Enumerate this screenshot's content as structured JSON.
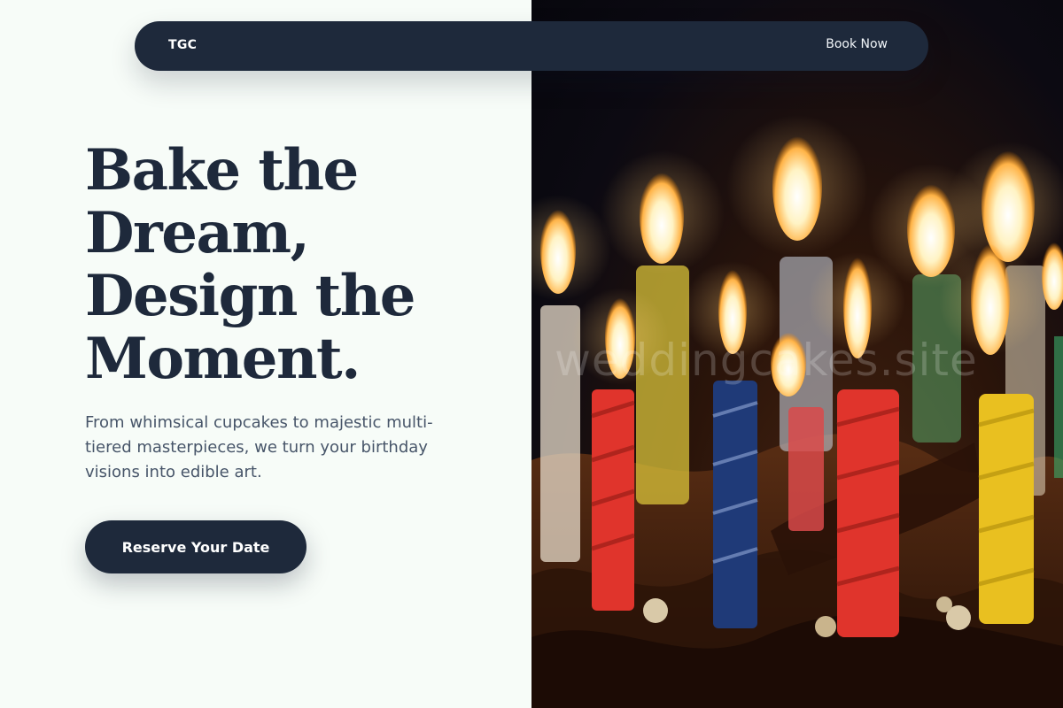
{
  "nav": {
    "logo": "TGC",
    "cta_label": "Book Now"
  },
  "hero": {
    "title_lines": [
      "Bake the",
      "Dream,",
      "Design the",
      "Moment."
    ],
    "subtitle": "From whimsical cupcakes to majestic multi-tiered masterpieces, we turn your birthday visions into edible art.",
    "button_label": "Reserve Your Date"
  },
  "image": {
    "subject": "birthday cake with lit candles",
    "watermark": "weddingcakes.site"
  },
  "colors": {
    "navy": "#1e293b",
    "background": "#f7fcf8",
    "body_text": "#475569"
  }
}
